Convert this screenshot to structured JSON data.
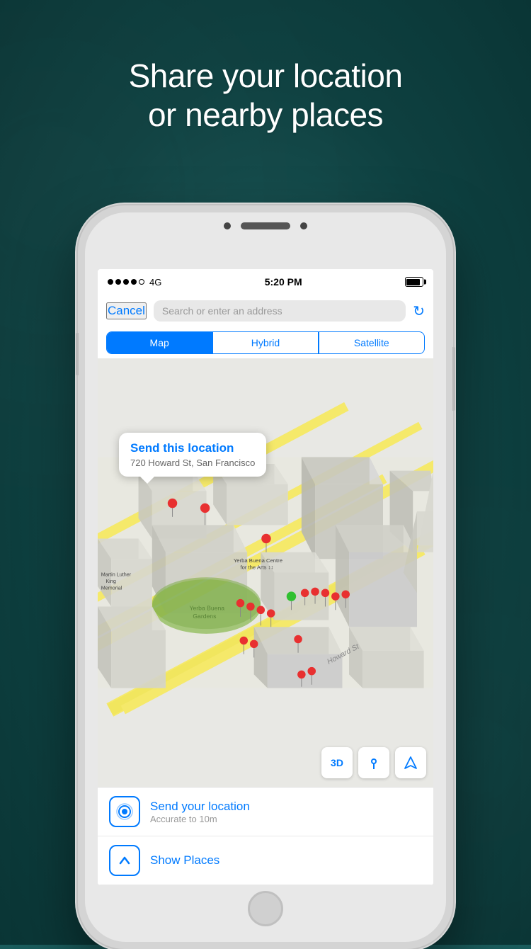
{
  "header": {
    "line1": "Share your location",
    "line2": "or nearby places"
  },
  "status_bar": {
    "signal_dots": 4,
    "network": "4G",
    "time": "5:20 PM",
    "battery_pct": 90
  },
  "search": {
    "cancel_label": "Cancel",
    "placeholder": "Search or enter an address"
  },
  "segment_control": {
    "items": [
      "Map",
      "Hybrid",
      "Satellite"
    ],
    "active_index": 0
  },
  "map": {
    "location_bubble": {
      "title": "Send this location",
      "address": "720 Howard St, San Francisco"
    },
    "labels": [
      "Yerba Buena\nGardens",
      "Yerba Buena Centre\nfor the Arts",
      "Martin Luther\nKing\nMemorial",
      "Howard St"
    ],
    "controls": [
      "3D",
      "📍",
      "➤"
    ]
  },
  "list_items": [
    {
      "icon_type": "location",
      "title": "Send your location",
      "subtitle": "Accurate to 10m"
    },
    {
      "icon_type": "chevron-up",
      "title": "Show Places",
      "subtitle": ""
    }
  ]
}
